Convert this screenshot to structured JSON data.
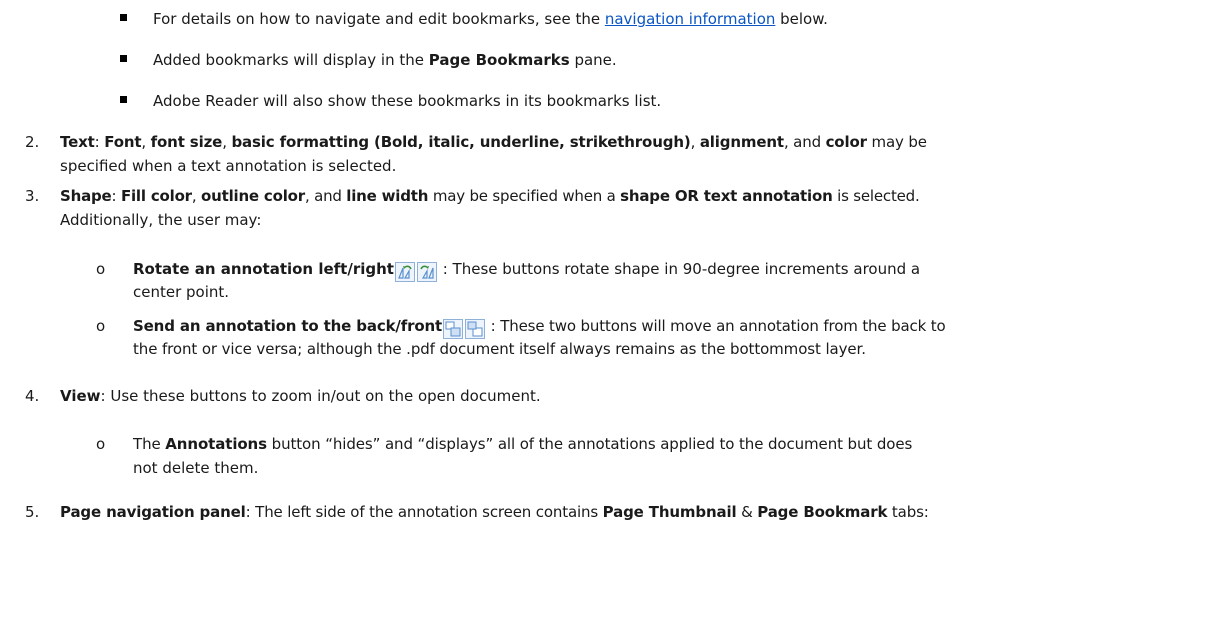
{
  "bookmarks_sub": {
    "b1_pre": "For details on how to navigate and edit bookmarks, see the ",
    "b1_link": "navigation information",
    "b1_post": " below.",
    "b2_pre": "Added bookmarks will display in the ",
    "b2_bold": "Page Bookmarks",
    "b2_post": " pane.",
    "b3": "Adobe Reader will also show these bookmarks in its bookmarks list."
  },
  "item2": {
    "num": "2.",
    "t1": "Text",
    "t2": ": ",
    "t3": "Font",
    "t4": ", ",
    "t5": "font size",
    "t6": ", ",
    "t7": "basic formatting (Bold, italic, underline, strikethrough)",
    "t8": ", ",
    "t9": "alignment",
    "t10": ", and ",
    "t11": "color",
    "t12": " may be",
    "line2": "specified when a text annotation is selected."
  },
  "item3": {
    "num": "3.",
    "t1": "Shape",
    "t2": ": ",
    "t3": "Fill color",
    "t4": ", ",
    "t5": "outline color",
    "t6": ", and ",
    "t7": "line width",
    "t8": " may be specified when a ",
    "t9": "shape OR text annotation",
    "t10": " is selected.",
    "line2": "Additionally, the user may:",
    "sub1_bold": "Rotate an annotation left/right",
    "sub1_rest": " : These buttons rotate shape in 90-degree increments around a",
    "sub1_line2": "center point.",
    "sub2_bold": "Send an annotation to the back/front",
    "sub2_rest": " : These two buttons will move an annotation from the back to",
    "sub2_line2": "the front or vice versa; although the .pdf document itself always remains as the bottommost layer."
  },
  "item4": {
    "num": "4.",
    "t1": "View",
    "t2": ": Use these buttons to zoom in/out on the open document.",
    "sub1_pre": "The ",
    "sub1_bold": "Annotations",
    "sub1_rest": " button “hides” and “displays” all of the annotations applied to the document but does",
    "sub1_line2": "not delete them."
  },
  "item5": {
    "num": "5.",
    "t1": "Page navigation panel",
    "t2": ": The left side of the annotation screen contains ",
    "t3": "Page Thumbnail",
    "t4": " & ",
    "t5": "Page Bookmark",
    "t6": " tabs:"
  },
  "glyphs": {
    "circle_bullet": "o"
  },
  "colors": {
    "link": "#0b55c4",
    "icon_green": "#3a8f3a",
    "icon_blue": "#5a8fd0"
  }
}
